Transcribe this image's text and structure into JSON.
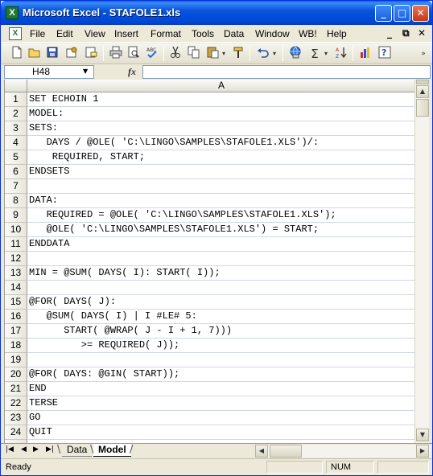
{
  "window": {
    "title": "Microsoft Excel - STAFOLE1.xls",
    "app_icon_glyph": "X",
    "minimize_glyph": "_",
    "maximize_glyph": "□",
    "close_glyph": "✕"
  },
  "menu": {
    "doc_icon_glyph": "X",
    "items": [
      "File",
      "Edit",
      "View",
      "Insert",
      "Format",
      "Tools",
      "Data",
      "Window",
      "WB!",
      "Help"
    ],
    "doc_min_glyph": "_",
    "doc_restore_glyph": "⧉",
    "doc_close_glyph": "✕"
  },
  "toolbar": {
    "icons": [
      "new-icon",
      "open-icon",
      "save-icon",
      "permission-icon",
      "email-icon",
      "print-icon",
      "print-preview-icon",
      "spelling-icon",
      "cut-icon",
      "copy-icon",
      "paste-icon",
      "format-painter-icon",
      "undo-icon",
      "hyperlink-icon",
      "autosum-icon",
      "sort-ascending-icon",
      "chart-wizard-icon",
      "help-icon",
      "toolbar-options-icon"
    ]
  },
  "formula_bar": {
    "name_box": "H48",
    "fx_label": "fx",
    "formula": ""
  },
  "sheet": {
    "column_header": "A",
    "rows": [
      {
        "num": "1",
        "text": "SET ECHOIN 1"
      },
      {
        "num": "2",
        "text": "MODEL:"
      },
      {
        "num": "3",
        "text": "SETS:"
      },
      {
        "num": "4",
        "text": "   DAYS / @OLE( 'C:\\LINGO\\SAMPLES\\STAFOLE1.XLS')/:"
      },
      {
        "num": "5",
        "text": "    REQUIRED, START;"
      },
      {
        "num": "6",
        "text": "ENDSETS"
      },
      {
        "num": "7",
        "text": ""
      },
      {
        "num": "8",
        "text": "DATA:"
      },
      {
        "num": "9",
        "text": "   REQUIRED = @OLE( 'C:\\LINGO\\SAMPLES\\STAFOLE1.XLS');"
      },
      {
        "num": "10",
        "text": "   @OLE( 'C:\\LINGO\\SAMPLES\\STAFOLE1.XLS') = START;"
      },
      {
        "num": "11",
        "text": "ENDDATA"
      },
      {
        "num": "12",
        "text": ""
      },
      {
        "num": "13",
        "text": "MIN = @SUM( DAYS( I): START( I));"
      },
      {
        "num": "14",
        "text": ""
      },
      {
        "num": "15",
        "text": "@FOR( DAYS( J):"
      },
      {
        "num": "16",
        "text": "   @SUM( DAYS( I) | I #LE# 5:"
      },
      {
        "num": "17",
        "text": "      START( @WRAP( J - I + 1, 7)))"
      },
      {
        "num": "18",
        "text": "         >= REQUIRED( J));"
      },
      {
        "num": "19",
        "text": ""
      },
      {
        "num": "20",
        "text": "@FOR( DAYS: @GIN( START));"
      },
      {
        "num": "21",
        "text": "END"
      },
      {
        "num": "22",
        "text": "TERSE"
      },
      {
        "num": "23",
        "text": "GO"
      },
      {
        "num": "24",
        "text": "QUIT"
      }
    ]
  },
  "tabs": {
    "nav_first": "|◀",
    "nav_prev": "◀",
    "nav_next": "▶",
    "nav_last": "▶|",
    "sheets": [
      "Data",
      "Model"
    ],
    "active": "Model"
  },
  "status": {
    "left": "Ready",
    "num_indicator": "NUM"
  }
}
